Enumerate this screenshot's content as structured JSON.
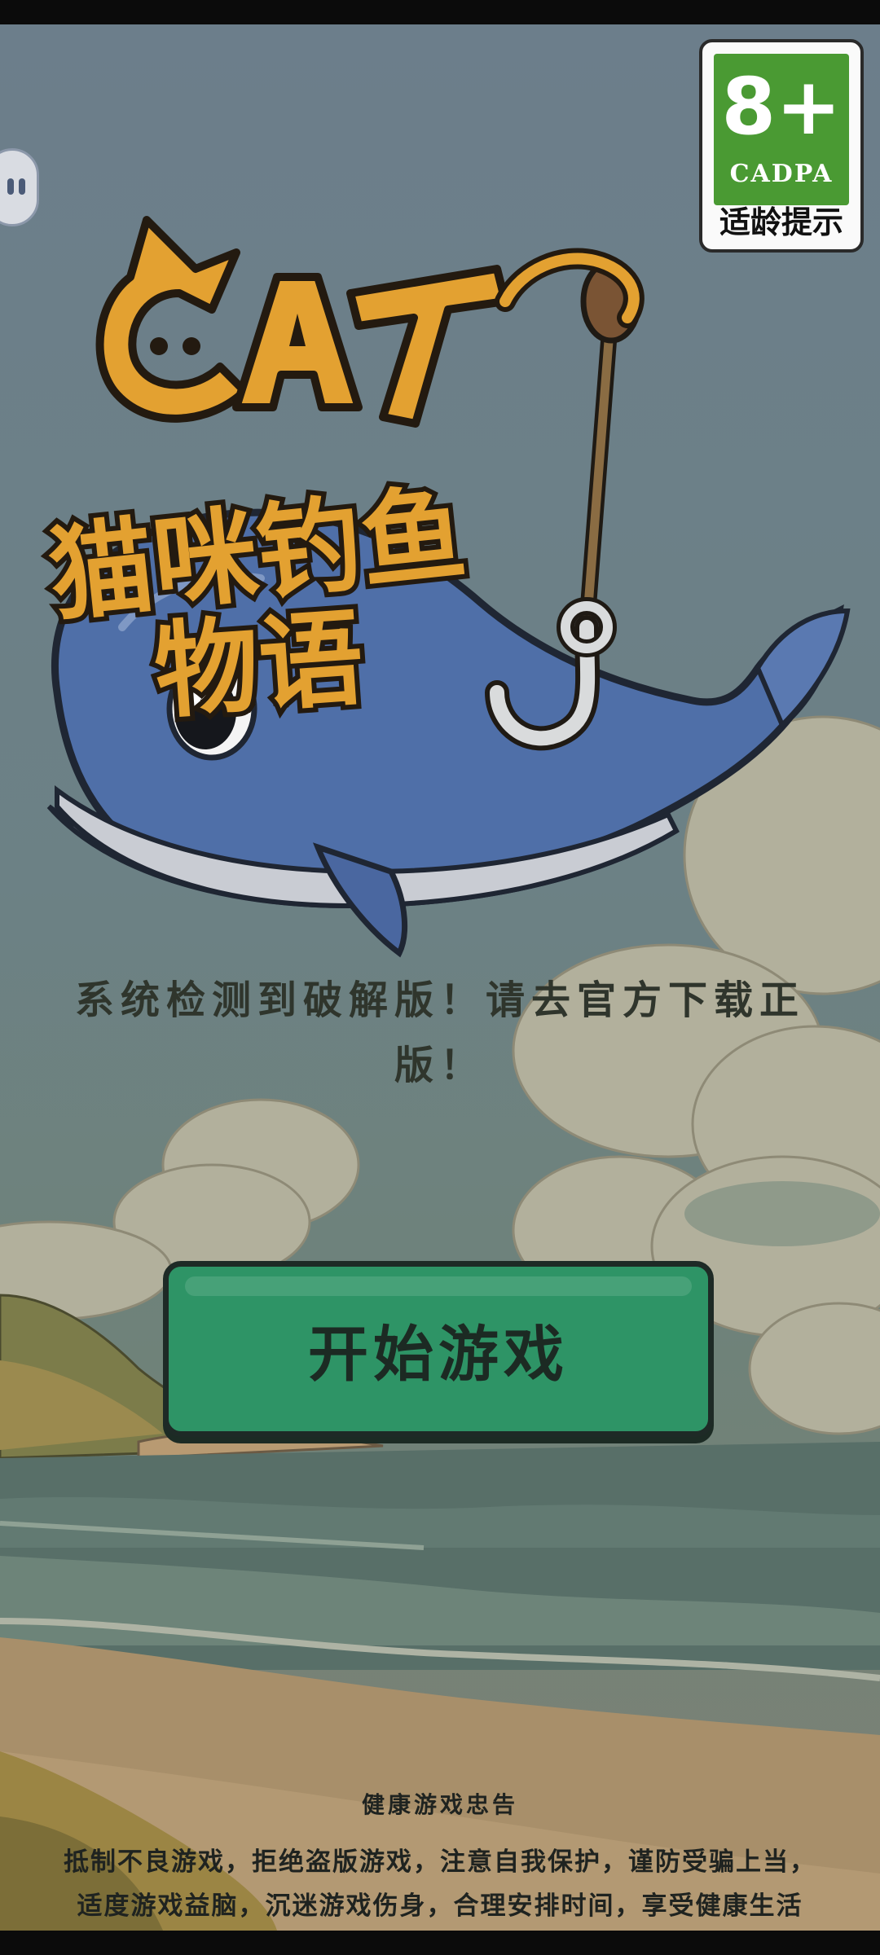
{
  "age_rating": {
    "age": "8+",
    "org": "CADPA",
    "tip": "适龄提示"
  },
  "logo": {
    "latin": "CAT",
    "title_line1": "猫咪钓鱼",
    "title_line2": "物语"
  },
  "warning_text": "系统检测到破解版！请去官方下载正版！",
  "start_button": {
    "label": "开始游戏"
  },
  "health_notice": {
    "title": "健康游戏忠告",
    "line1": "抵制不良游戏，拒绝盗版游戏，注意自我保护，谨防受骗上当，",
    "line2": "适度游戏益脑，沉迷游戏伤身，合理安排时间，享受健康生活"
  },
  "colors": {
    "rating_green": "#4a9a33",
    "button_green": "#2e9466",
    "logo_orange": "#e3a131",
    "whale_blue": "#4f6fa8"
  }
}
